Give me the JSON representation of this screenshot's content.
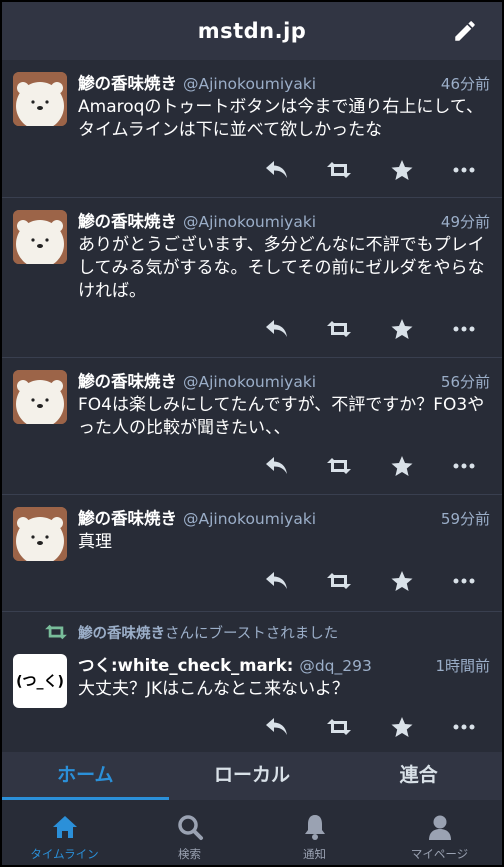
{
  "header": {
    "title": "mstdn.jp",
    "compose_icon": "pencil-icon"
  },
  "statuses": [
    {
      "display_name": "鯵の香味焼き",
      "acct": "@Ajinokoumiyaki",
      "time": "46分前",
      "content": "Amaroqのトゥートボタンは今まで通り右上にして、タイムラインは下に並べて欲しかったな"
    },
    {
      "display_name": "鯵の香味焼き",
      "acct": "@Ajinokoumiyaki",
      "time": "49分前",
      "content": "ありがとうございます、多分どんなに不評でもプレイしてみる気がするな。そしてその前にゼルダをやらなければ。"
    },
    {
      "display_name": "鯵の香味焼き",
      "acct": "@Ajinokoumiyaki",
      "time": "56分前",
      "content": "FO4は楽しみにしてたんですが、不評ですか？FO3やった人の比較が聞きたい、、"
    },
    {
      "display_name": "鯵の香味焼き",
      "acct": "@Ajinokoumiyaki",
      "time": "59分前",
      "content": "真理"
    },
    {
      "boosted_by": "鯵の香味焼き",
      "boost_suffix": "さんにブーストされました",
      "avatar_text": "(つ_く)",
      "display_name": "つく:white_check_mark:",
      "acct": "@dq_293",
      "time": "1時間前",
      "content": "大丈夫？JKはこんなとこ来ないよ？"
    }
  ],
  "tabs": [
    "ホーム",
    "ローカル",
    "連合"
  ],
  "bottom_nav": [
    {
      "label": "タイムライン",
      "icon": "home-icon"
    },
    {
      "label": "検索",
      "icon": "search-icon"
    },
    {
      "label": "通知",
      "icon": "bell-icon"
    },
    {
      "label": "マイページ",
      "icon": "user-icon"
    }
  ],
  "colors": {
    "background": "#282c37",
    "accent": "#2b90d9",
    "boost": "#79bd9a",
    "secondary_text": "#9baec8"
  }
}
